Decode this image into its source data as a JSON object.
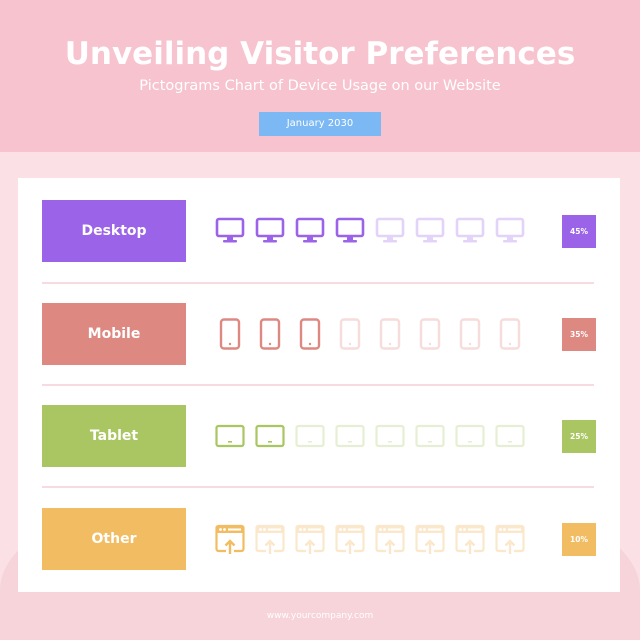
{
  "header": {
    "title": "Unveiling Visitor Preferences",
    "subtitle": "Pictograms Chart of Device Usage on our Website",
    "date": "January 2030"
  },
  "rows": [
    {
      "label": "Desktop",
      "percent": "45%",
      "icon": "desktop-icon",
      "filled": 4,
      "total": 8,
      "color": "#9b63e8",
      "faded": "#e3d3f8"
    },
    {
      "label": "Mobile",
      "percent": "35%",
      "icon": "mobile-icon",
      "filled": 3,
      "total": 8,
      "color": "#de8882",
      "faded": "#f6dcda"
    },
    {
      "label": "Tablet",
      "percent": "25%",
      "icon": "tablet-icon",
      "filled": 2,
      "total": 8,
      "color": "#a9c662",
      "faded": "#e6efd3"
    },
    {
      "label": "Other",
      "percent": "10%",
      "icon": "browser-upload-icon",
      "filled": 1,
      "total": 8,
      "color": "#f2bc62",
      "faded": "#fbe8cc"
    }
  ],
  "footer": {
    "url": "www.yourcompany.com"
  }
}
